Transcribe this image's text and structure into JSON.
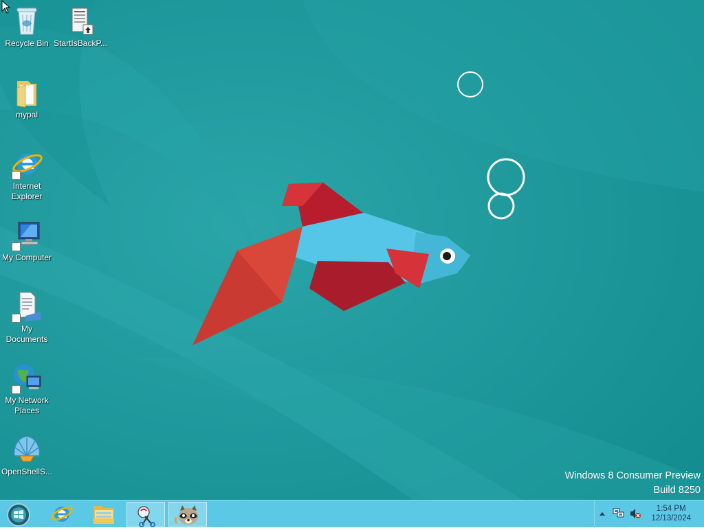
{
  "desktop": {
    "icons": [
      {
        "id": "recycle-bin",
        "label": "Recycle Bin",
        "icon": "recycle-bin-icon"
      },
      {
        "id": "startisback",
        "label": "StartIsBackP...",
        "icon": "installer-icon"
      },
      {
        "id": "mypal",
        "label": "mypal",
        "icon": "folder-icon"
      },
      {
        "id": "internet-explorer",
        "label": "Internet\nExplorer",
        "icon": "internet-explorer-icon"
      },
      {
        "id": "my-computer",
        "label": "My Computer",
        "icon": "computer-icon"
      },
      {
        "id": "my-documents",
        "label": "My\nDocuments",
        "icon": "documents-icon"
      },
      {
        "id": "my-network-places",
        "label": "My Network\nPlaces",
        "icon": "network-icon"
      },
      {
        "id": "openshell",
        "label": "OpenShellS...",
        "icon": "shell-icon"
      }
    ]
  },
  "watermark": {
    "line1": "Windows 8 Consumer Preview",
    "line2": "Build 8250"
  },
  "taskbar": {
    "start_icon": "start-orb-icon",
    "pinned": [
      {
        "id": "ie",
        "icon": "internet-explorer-icon",
        "active": false
      },
      {
        "id": "explorer",
        "icon": "file-explorer-icon",
        "active": false
      },
      {
        "id": "snipping",
        "icon": "snipping-tool-icon",
        "active": true
      },
      {
        "id": "mypal",
        "icon": "mypal-raccoon-icon",
        "active": true
      }
    ],
    "tray": {
      "icons": [
        "show-hidden-icons-icon",
        "network-icon",
        "volume-muted-icon"
      ],
      "time": "1:54 PM",
      "date": "12/13/2024"
    }
  },
  "colors": {
    "wallpaper": "#1a9a9a",
    "taskbar": "#5bc8e6",
    "fish_body": "#55c6e8",
    "fish_fin_red": "#b5202e",
    "fish_fin_orange": "#d84a3a"
  }
}
